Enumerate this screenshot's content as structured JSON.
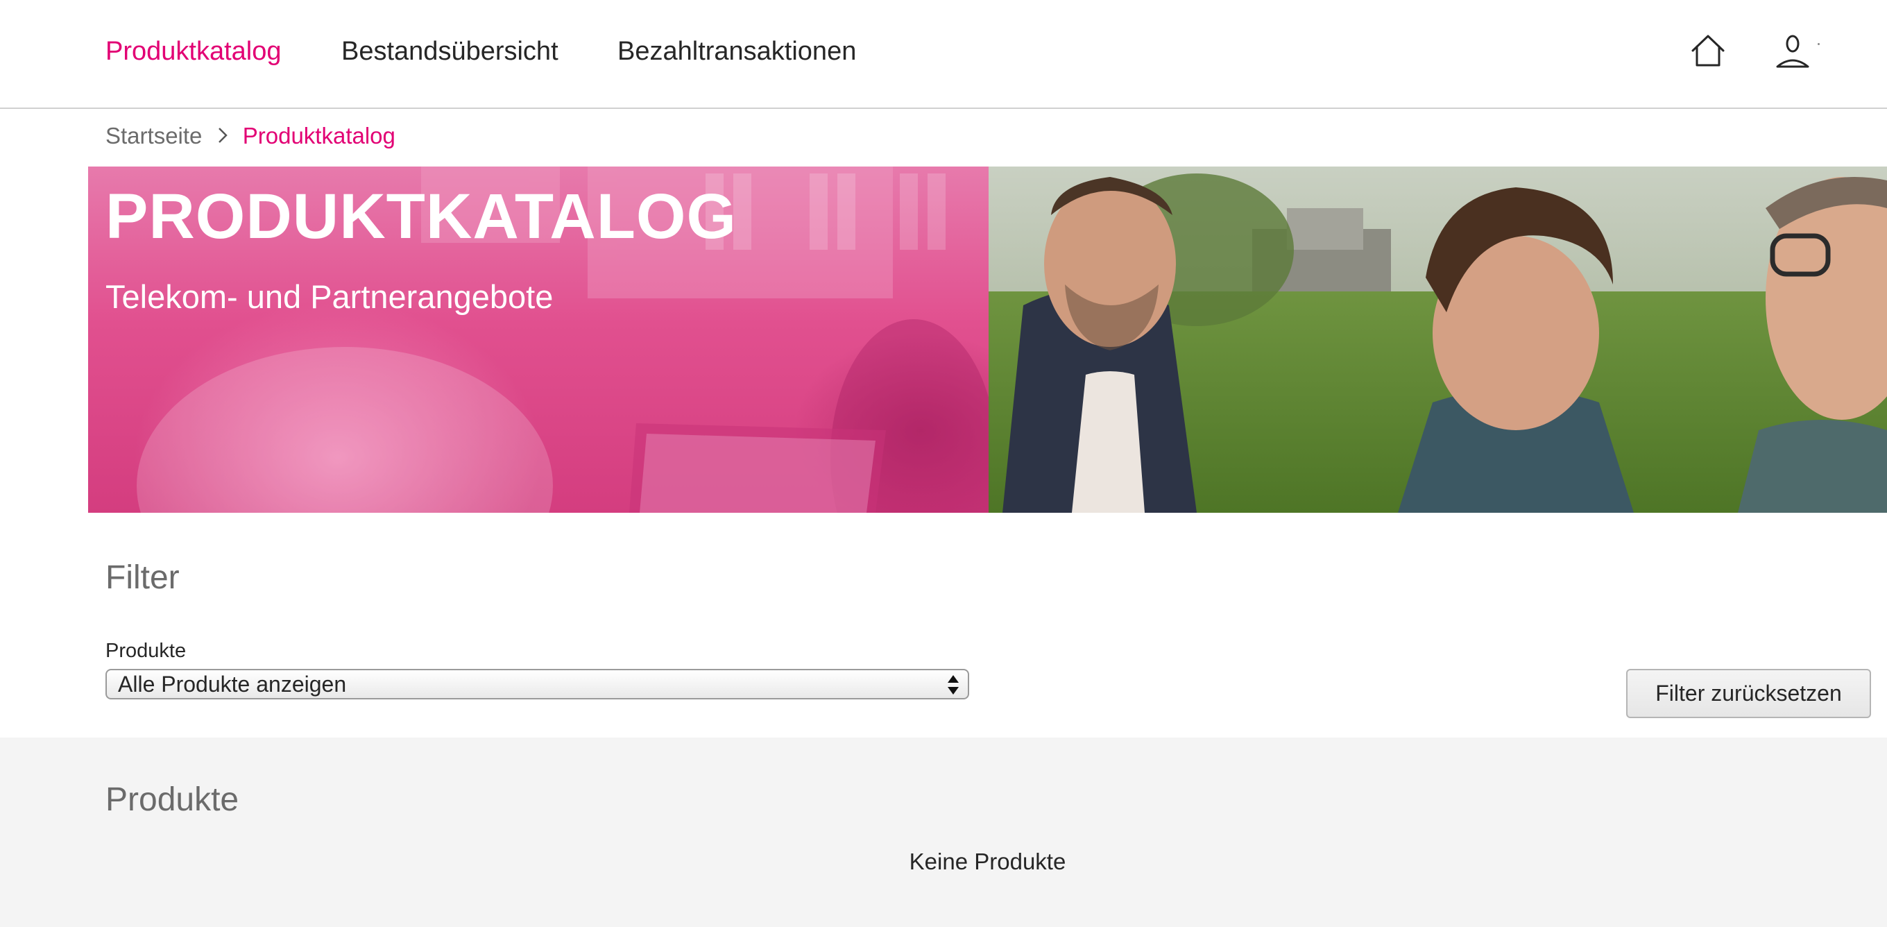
{
  "nav": {
    "items": [
      {
        "label": "Produktkatalog",
        "active": true
      },
      {
        "label": "Bestandsübersicht",
        "active": false
      },
      {
        "label": "Bezahltransaktionen",
        "active": false
      }
    ],
    "icons": [
      "home-icon",
      "user-icon"
    ]
  },
  "breadcrumb": {
    "home": "Startseite",
    "current": "Produktkatalog"
  },
  "hero": {
    "title": "PRODUKTKATALOG",
    "subtitle": "Telekom- und Partnerangebote"
  },
  "filter": {
    "heading": "Filter",
    "products_label": "Produkte",
    "products_selected": "Alle Produkte anzeigen",
    "reset_label": "Filter zurücksetzen"
  },
  "products": {
    "heading": "Produkte",
    "empty_message": "Keine Produkte"
  },
  "colors": {
    "brand": "#e20074",
    "text": "#262626",
    "muted": "#6b6b6b",
    "section_bg": "#f4f4f4"
  }
}
